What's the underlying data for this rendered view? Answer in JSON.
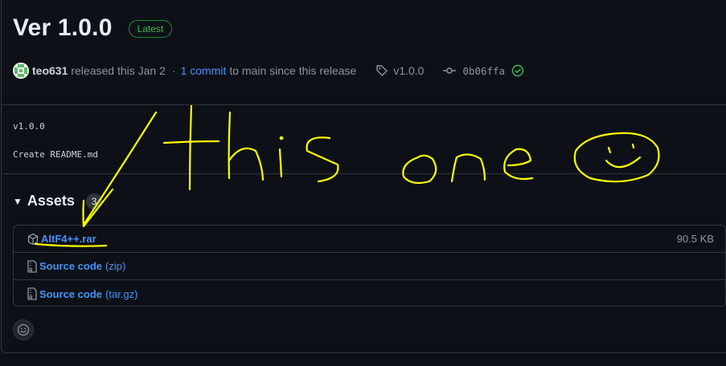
{
  "release": {
    "title": "Ver 1.0.0",
    "badge": "Latest",
    "author": "teo631",
    "released_text": "released this Jan 2",
    "separator": "·",
    "commit_link": "1 commit",
    "commit_suffix": "to main since this release",
    "tag": "v1.0.0",
    "commit_hash": "0b06ffa"
  },
  "body": {
    "line1": "v1.0.0",
    "line2": "Create README.md"
  },
  "assets": {
    "title": "Assets",
    "count": "3",
    "items": [
      {
        "name": "AltF4++.rar",
        "suffix": "",
        "size": "90.5 KB",
        "icon": "package-icon"
      },
      {
        "name": "Source code",
        "suffix": "(zip)",
        "size": "",
        "icon": "file-zip-icon"
      },
      {
        "name": "Source code",
        "suffix": "(tar.gz)",
        "size": "",
        "icon": "file-zip-icon"
      }
    ]
  },
  "annotation": {
    "handwritten_text": "this one",
    "color": "#ffff00"
  },
  "colors": {
    "background": "#0d1117",
    "link": "#4493f8",
    "success": "#3fb950",
    "border": "#30363d",
    "muted": "#8b949e"
  },
  "icons": [
    "avatar",
    "tag-icon",
    "git-commit-icon",
    "check-circle-icon",
    "caret-down-icon",
    "package-icon",
    "file-zip-icon",
    "smiley-icon"
  ]
}
